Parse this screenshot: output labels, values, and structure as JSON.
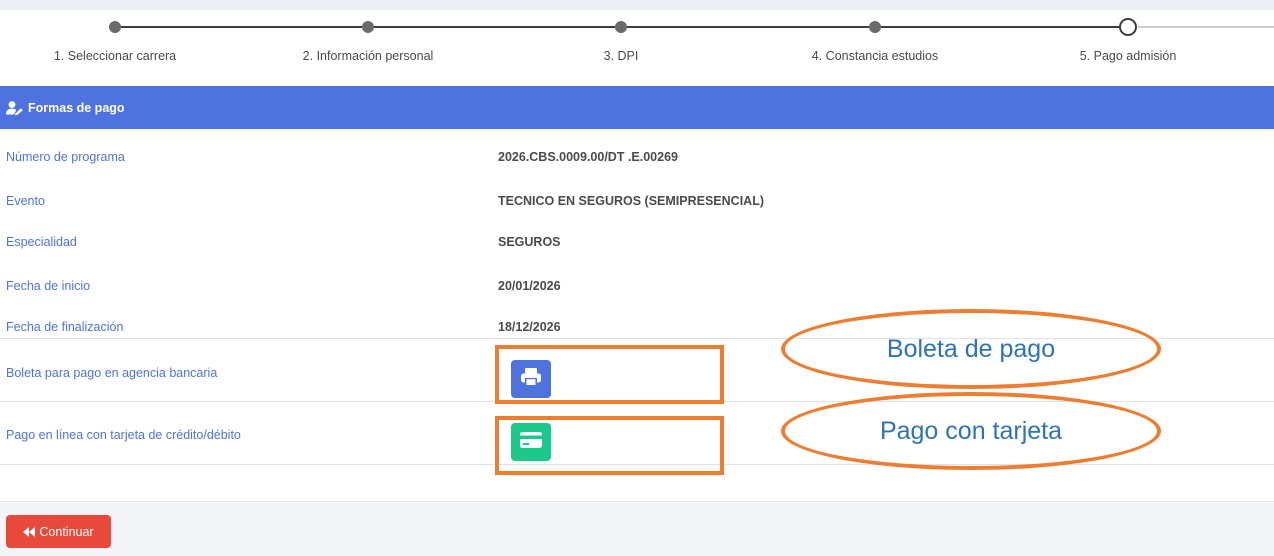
{
  "stepper": {
    "steps": [
      {
        "label": "1. Seleccionar carrera",
        "state": "done"
      },
      {
        "label": "2. Información personal",
        "state": "done"
      },
      {
        "label": "3. DPI",
        "state": "done"
      },
      {
        "label": "4. Constancia estudios",
        "state": "done"
      },
      {
        "label": "5. Pago admisión",
        "state": "current"
      }
    ]
  },
  "card": {
    "title": "Formas de pago",
    "rows": [
      {
        "label": "Número de programa",
        "value": "2026.CBS.0009.00/DT .E.00269"
      },
      {
        "label": "Evento",
        "value": "TECNICO EN SEGUROS (SEMIPRESENCIAL)"
      },
      {
        "label": "Especialidad",
        "value": "SEGUROS"
      },
      {
        "label": "Fecha de inicio",
        "value": "20/01/2026"
      },
      {
        "label": "Fecha de finalización",
        "value": "18/12/2026"
      }
    ],
    "payments": [
      {
        "label": "Boleta para pago en agencia bancaria",
        "icon": "printer-icon",
        "color": "#4e73df"
      },
      {
        "label": "Pago en línea con tarjeta de crédito/débito",
        "icon": "credit-card-icon",
        "color": "#1cc88a"
      }
    ]
  },
  "annotations": {
    "boleta": "Boleta de pago",
    "tarjeta": "Pago con tarjeta",
    "color": "#ed7d31"
  },
  "footer": {
    "continue_label": "Continuar",
    "continue_icon": "backward-icon",
    "continue_color": "#e74a3b"
  }
}
